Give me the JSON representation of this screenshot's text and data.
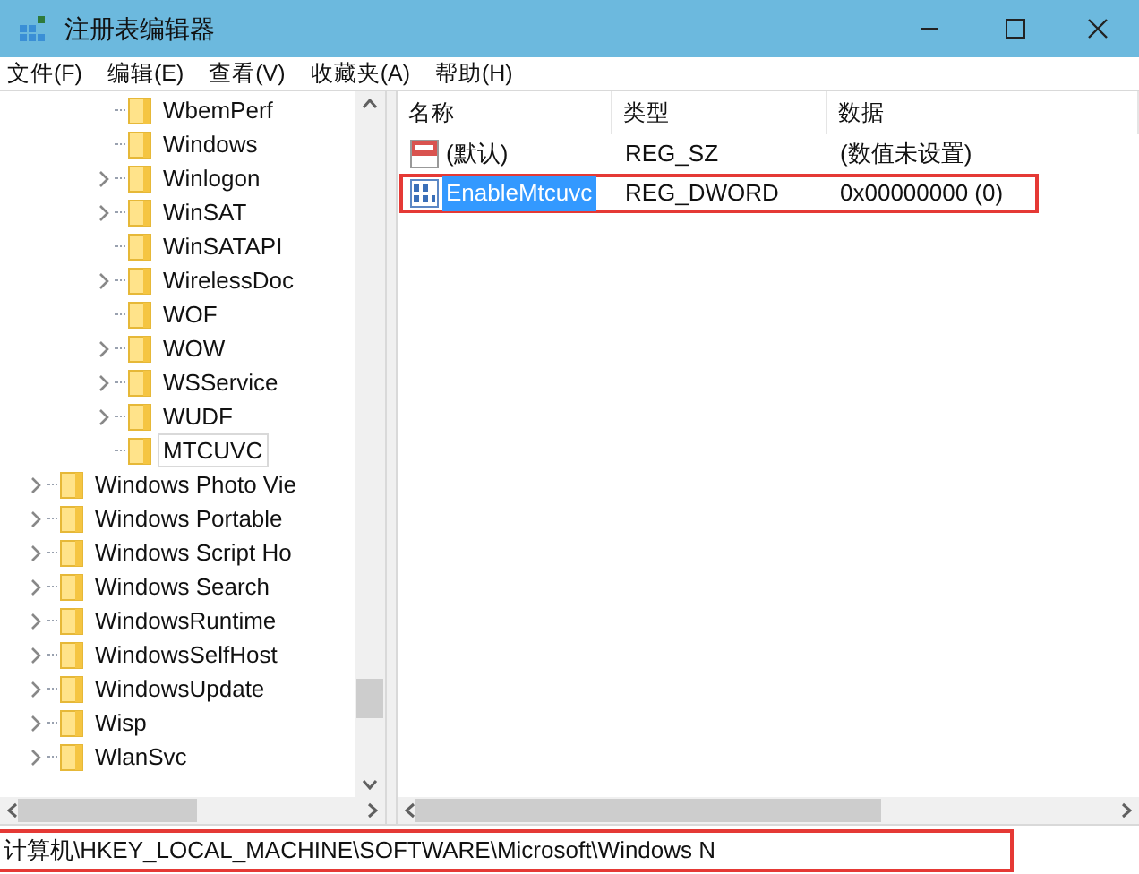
{
  "window": {
    "title": "注册表编辑器"
  },
  "menu": [
    "文件(F)",
    "编辑(E)",
    "查看(V)",
    "收藏夹(A)",
    "帮助(H)"
  ],
  "tree": {
    "subitems": [
      {
        "label": "WbemPerf",
        "expandable": false,
        "selected": false
      },
      {
        "label": "Windows",
        "expandable": false,
        "selected": false
      },
      {
        "label": "Winlogon",
        "expandable": true,
        "selected": false
      },
      {
        "label": "WinSAT",
        "expandable": true,
        "selected": false
      },
      {
        "label": "WinSATAPI",
        "expandable": false,
        "selected": false
      },
      {
        "label": "WirelessDoc",
        "expandable": true,
        "selected": false
      },
      {
        "label": "WOF",
        "expandable": false,
        "selected": false
      },
      {
        "label": "WOW",
        "expandable": true,
        "selected": false
      },
      {
        "label": "WSService",
        "expandable": true,
        "selected": false
      },
      {
        "label": "WUDF",
        "expandable": true,
        "selected": false
      },
      {
        "label": "MTCUVC",
        "expandable": false,
        "selected": true
      }
    ],
    "items": [
      {
        "label": "Windows Photo Vie",
        "expandable": true,
        "selected": false
      },
      {
        "label": "Windows Portable",
        "expandable": true,
        "selected": false
      },
      {
        "label": "Windows Script Ho",
        "expandable": true,
        "selected": false
      },
      {
        "label": "Windows Search",
        "expandable": true,
        "selected": false
      },
      {
        "label": "WindowsRuntime",
        "expandable": true,
        "selected": false
      },
      {
        "label": "WindowsSelfHost",
        "expandable": true,
        "selected": false
      },
      {
        "label": "WindowsUpdate",
        "expandable": true,
        "selected": false
      },
      {
        "label": "Wisp",
        "expandable": true,
        "selected": false
      },
      {
        "label": "WlanSvc",
        "expandable": true,
        "selected": false
      }
    ]
  },
  "values": {
    "columns": [
      "名称",
      "类型",
      "数据"
    ],
    "rows": [
      {
        "kind": "string",
        "name": "(默认)",
        "type": "REG_SZ",
        "data": "(数值未设置)",
        "selected": false,
        "highlighted": false
      },
      {
        "kind": "binary",
        "name": "EnableMtcuvc",
        "type": "REG_DWORD",
        "data": "0x00000000 (0)",
        "selected": true,
        "highlighted": true
      }
    ]
  },
  "status_bar": {
    "path": "计算机\\HKEY_LOCAL_MACHINE\\SOFTWARE\\Microsoft\\Windows N",
    "highlighted": true
  }
}
